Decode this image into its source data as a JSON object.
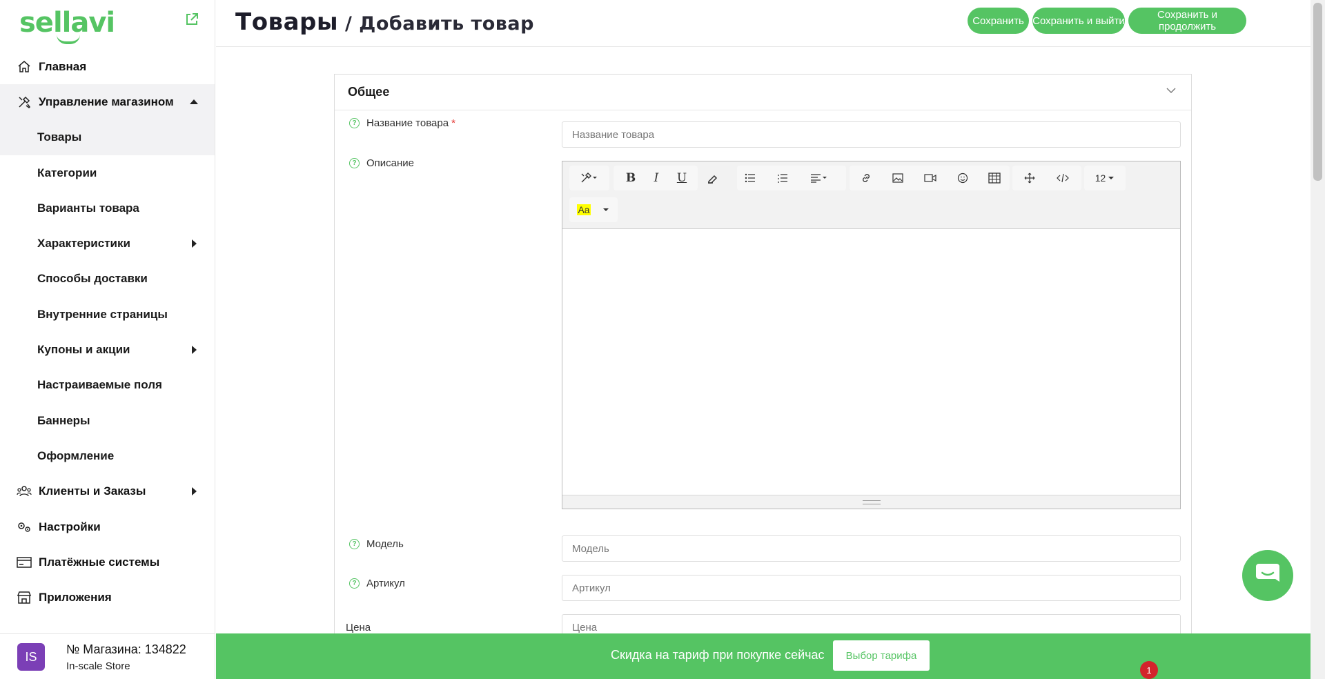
{
  "brand": {
    "logo_text": "sellavi",
    "accent": "#55c463"
  },
  "sidebar": {
    "items": [
      {
        "label": "Главная",
        "icon": "home-icon"
      },
      {
        "label": "Управление магазином",
        "icon": "tools-icon"
      },
      {
        "label": "Товары"
      },
      {
        "label": "Категории"
      },
      {
        "label": "Варианты товара"
      },
      {
        "label": "Характеристики"
      },
      {
        "label": "Способы доставки"
      },
      {
        "label": "Внутренние страницы"
      },
      {
        "label": "Купоны и акции"
      },
      {
        "label": "Настраиваемые поля"
      },
      {
        "label": "Баннеры"
      },
      {
        "label": "Оформление"
      },
      {
        "label": "Клиенты и Заказы",
        "icon": "users-icon"
      },
      {
        "label": "Настройки",
        "icon": "gears-icon"
      },
      {
        "label": "Платёжные системы",
        "icon": "card-icon"
      },
      {
        "label": "Приложения",
        "icon": "store-icon"
      }
    ],
    "store": {
      "avatar": "IS",
      "number": "№ Магазина: 134822",
      "name": "In-scale Store"
    }
  },
  "header": {
    "title": "Товары",
    "separator": " / ",
    "subtitle": "Добавить товар",
    "buttons": {
      "save": "Сохранить",
      "save_exit": "Сохранить и выйти",
      "save_continue": "Сохранить и продолжить"
    }
  },
  "form": {
    "section_title": "Общее",
    "name_label": "Название товара",
    "required_mark": "*",
    "name_placeholder": "Название товара",
    "description_label": "Описание",
    "font_size": "12",
    "highlight_sample": "Aa",
    "model_label": "Модель",
    "model_placeholder": "Модель",
    "sku_label": "Артикул",
    "sku_placeholder": "Артикул",
    "price_label": "Цена",
    "price_placeholder": "Цена"
  },
  "promo": {
    "text": "Скидка на тариф при покупке сейчас",
    "button": "Выбор тарифа",
    "badge": "1"
  }
}
